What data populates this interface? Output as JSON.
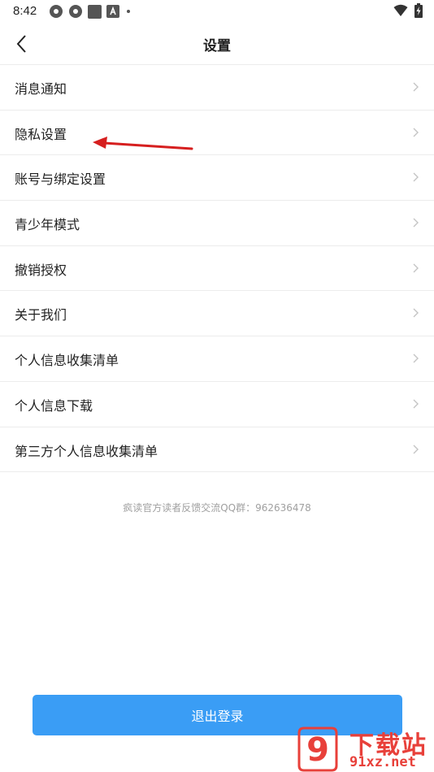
{
  "status_bar": {
    "time": "8:42",
    "notification_icons": [
      "aperture-icon",
      "aperture-icon",
      "square-icon",
      "a-box-icon",
      "dot-icon"
    ],
    "right_icons": [
      "wifi-icon",
      "battery-charging-icon"
    ]
  },
  "header": {
    "title": "设置",
    "back_icon": "chevron-left-icon"
  },
  "menu": {
    "items": [
      {
        "label": "消息通知"
      },
      {
        "label": "隐私设置"
      },
      {
        "label": "账号与绑定设置"
      },
      {
        "label": "青少年模式"
      },
      {
        "label": "撤销授权"
      },
      {
        "label": "关于我们"
      },
      {
        "label": "个人信息收集清单"
      },
      {
        "label": "个人信息下载"
      },
      {
        "label": "第三方个人信息收集清单"
      }
    ],
    "chevron_icon": "chevron-right-icon"
  },
  "footer": {
    "contact_text": "疯读官方读者反馈交流QQ群：962636478",
    "logout_label": "退出登录"
  },
  "watermark": {
    "big_text": "下载站",
    "small_text": "91xz.net",
    "logo_text": "9"
  },
  "colors": {
    "accent": "#3a9df5",
    "annotation_arrow": "#d61f1f",
    "watermark": "#e8403a"
  }
}
